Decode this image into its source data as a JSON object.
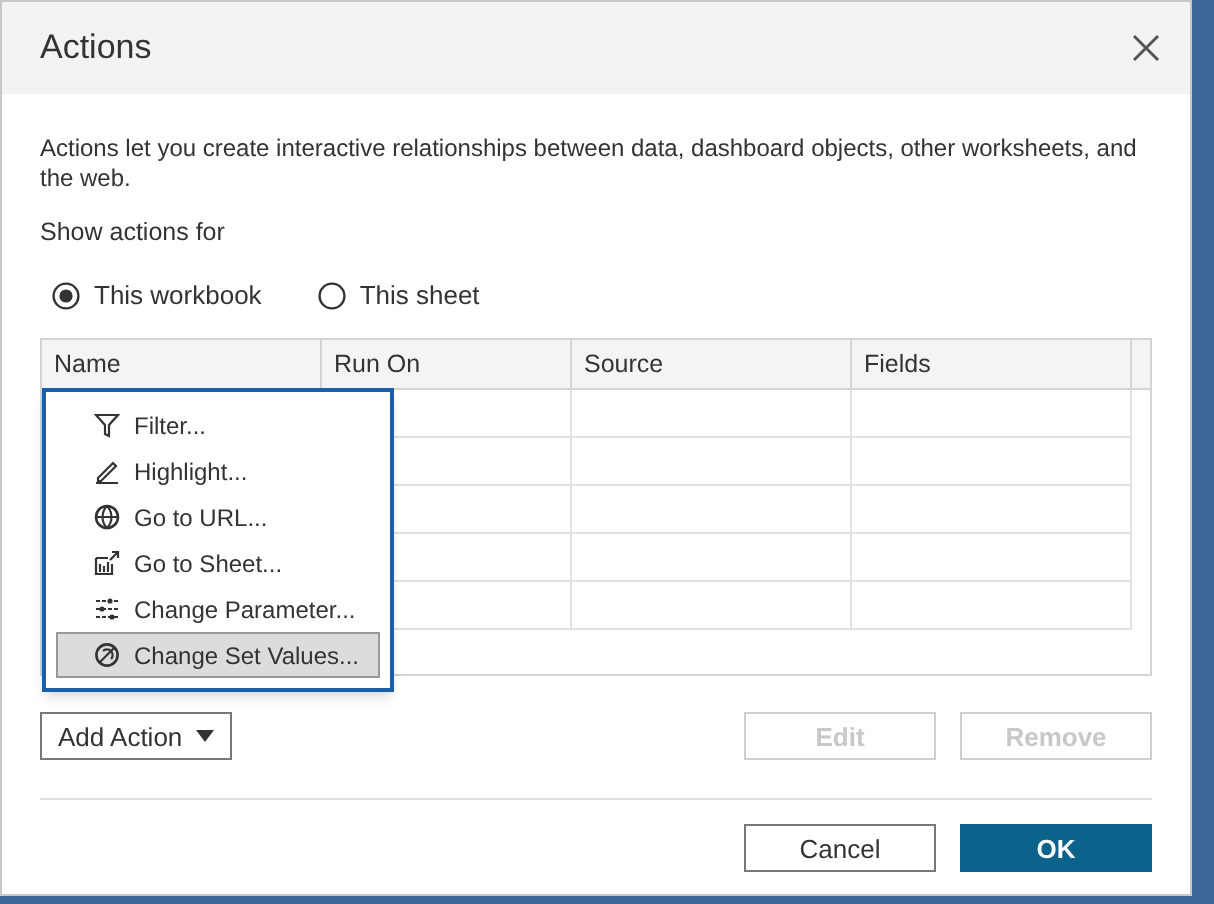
{
  "dialog": {
    "title": "Actions",
    "description": "Actions let you create interactive relationships between data, dashboard objects, other worksheets, and the web.",
    "show_actions_label": "Show actions for",
    "scope_options": [
      {
        "label": "This workbook",
        "selected": true
      },
      {
        "label": "This sheet",
        "selected": false
      }
    ],
    "table": {
      "columns": [
        "Name",
        "Run On",
        "Source",
        "Fields"
      ]
    },
    "add_action": {
      "label": "Add Action",
      "expanded": true
    },
    "menu": [
      {
        "kind": "filter",
        "label": "Filter...",
        "selected": false
      },
      {
        "kind": "highlight",
        "label": "Highlight...",
        "selected": false
      },
      {
        "kind": "url",
        "label": "Go to URL...",
        "selected": false
      },
      {
        "kind": "sheet",
        "label": "Go to Sheet...",
        "selected": false
      },
      {
        "kind": "parameter",
        "label": "Change Parameter...",
        "selected": false
      },
      {
        "kind": "set",
        "label": "Change Set Values...",
        "selected": true
      }
    ],
    "buttons": [
      {
        "kind": "secondary",
        "label": "Edit",
        "disabled": true
      },
      {
        "kind": "secondary",
        "label": "Remove",
        "disabled": true
      },
      {
        "kind": "secondary",
        "label": "Cancel",
        "disabled": false
      },
      {
        "kind": "primary",
        "label": "OK",
        "disabled": false
      }
    ]
  }
}
